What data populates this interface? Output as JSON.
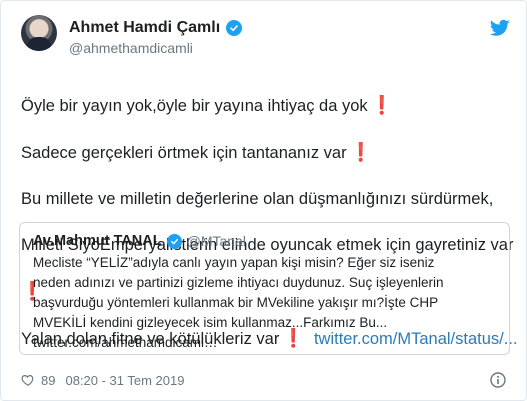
{
  "author": {
    "name": "Ahmet Hamdi Çamlı",
    "handle": "@ahmethamdicamli"
  },
  "tweet": {
    "lines": [
      {
        "text": "Öyle bir yayın yok,öyle bir yayına ihtiyaç da yok",
        "excl": "❗"
      },
      {
        "text": "Sadece gerçekleri örtmek için tantananız var",
        "excl": "❗"
      },
      {
        "text": "Bu millete ve milletin değerlerine olan düşmanlığınızı sürdürmek,",
        "excl": ""
      },
      {
        "text": "Milleti SiyoEmperyalistlerin elinde oyuncak etmek için gayretiniz var",
        "excl": ""
      },
      {
        "text": "",
        "excl": "❗"
      },
      {
        "text": "Yalan,dolan,fitne ve kötülükleriz var",
        "excl": "❗"
      }
    ],
    "link": "twitter.com/MTanal/status/..."
  },
  "quote": {
    "name": "Av.Mahmut TANAL",
    "handle": "@MTanal",
    "lines": [
      "Mecliste “YELİZ”adıyla canlı yayın yapan kişi misin? Eğer siz iseniz",
      "neden adınızı ve partinizi gizleme ihtiyacı duydunuz. Suç işleyenlerin",
      "başvurduğu yöntemleri kullanmak bir MVekiline yakışır mı?İşte CHP",
      "MVEKİLİ kendini gizleyecek isim kullanmaz...Farkımız Bu...",
      "twitter.com/ahmethamdicaml…"
    ]
  },
  "footer": {
    "likes": "89",
    "datetime": "08:20 - 31 Tem 2019"
  },
  "colors": {
    "twitter_blue": "#1da1f2",
    "link": "#2b7bb9",
    "muted": "#697882",
    "exclamation": "#d4111b"
  }
}
